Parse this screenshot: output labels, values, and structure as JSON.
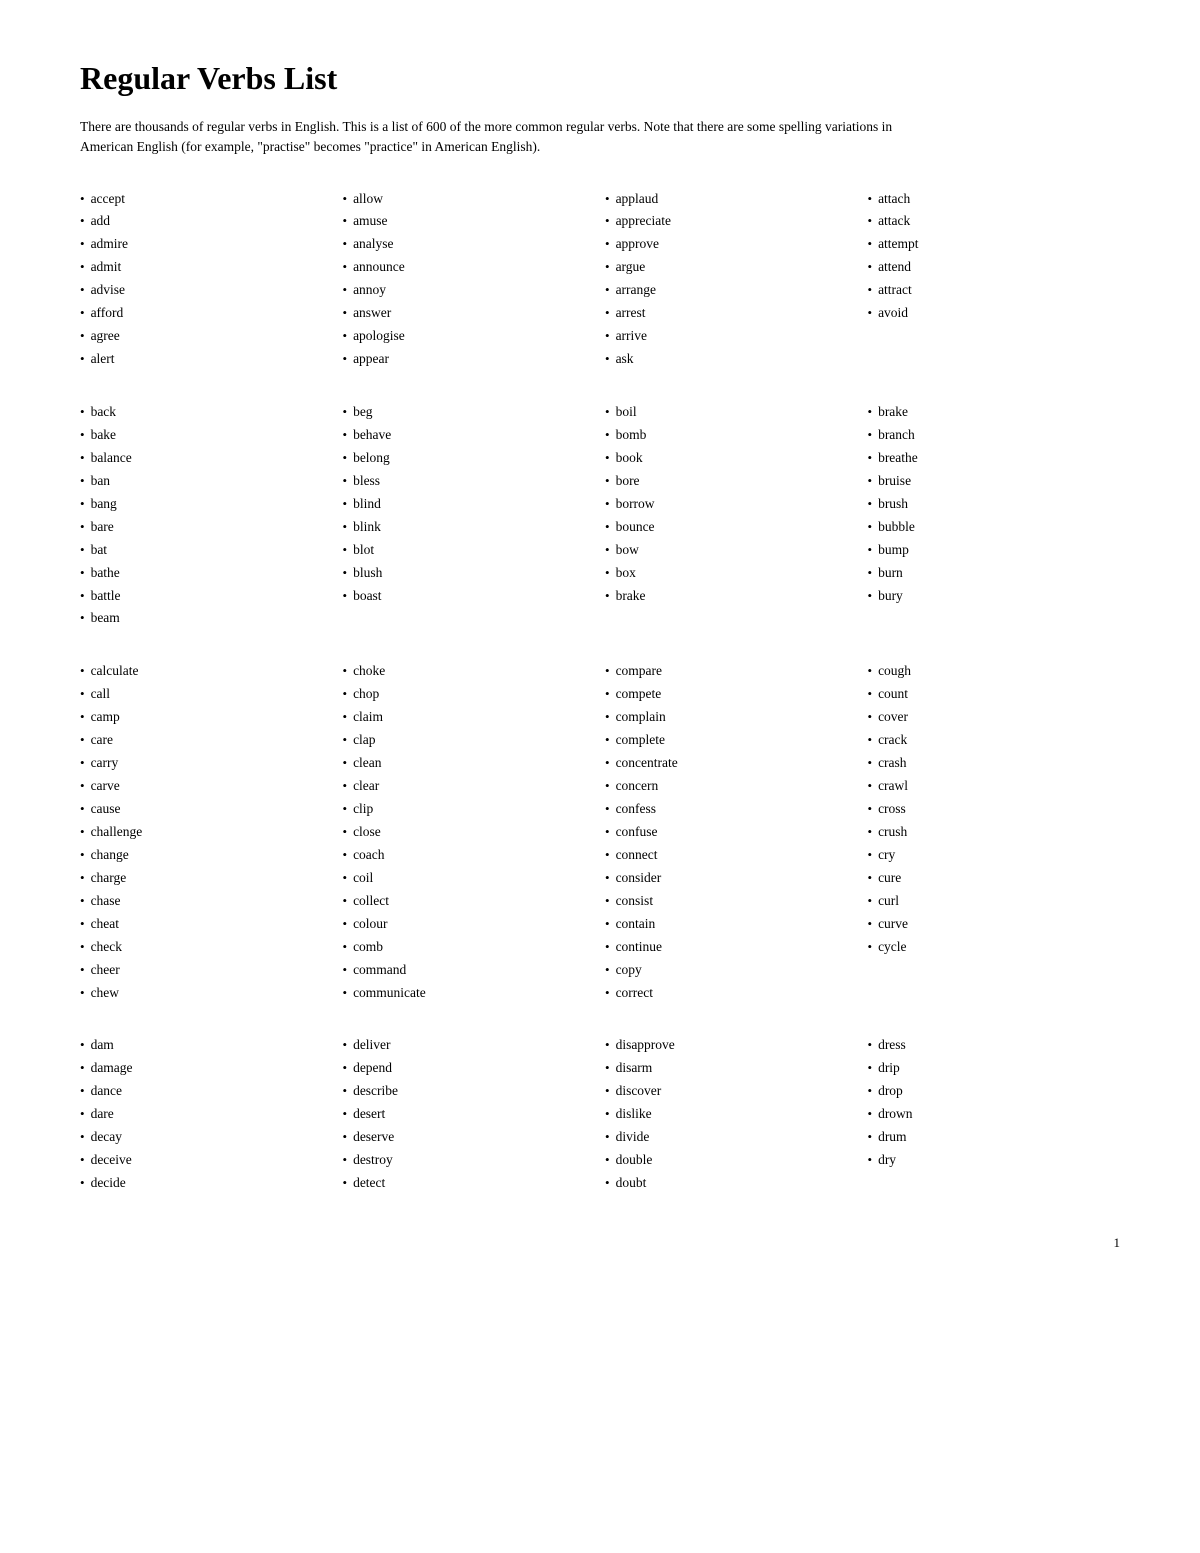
{
  "title": "Regular Verbs List",
  "intro": "There are thousands of regular verbs in English. This is a list of 600 of the more common regular verbs. Note that there are some spelling variations in American English (for example, \"practise\" becomes \"practice\" in American English).",
  "page_number": "1",
  "sections": [
    {
      "id": "a-section",
      "columns": [
        [
          "accept",
          "add",
          "admire",
          "admit",
          "advise",
          "afford",
          "agree",
          "alert"
        ],
        [
          "allow",
          "amuse",
          "analyse",
          "announce",
          "annoy",
          "answer",
          "apologise",
          "appear"
        ],
        [
          "applaud",
          "appreciate",
          "approve",
          "argue",
          "arrange",
          "arrest",
          "arrive",
          "ask"
        ],
        [
          "attach",
          "attack",
          "attempt",
          "attend",
          "attract",
          "avoid"
        ]
      ]
    },
    {
      "id": "b-section",
      "columns": [
        [
          "back",
          "bake",
          "balance",
          "ban",
          "bang",
          "bare",
          "bat",
          "bathe",
          "battle",
          "beam"
        ],
        [
          "beg",
          "behave",
          "belong",
          "bless",
          "blind",
          "blink",
          "blot",
          "blush",
          "boast"
        ],
        [
          "boil",
          "bomb",
          "book",
          "bore",
          "borrow",
          "bounce",
          "bow",
          "box",
          "brake"
        ],
        [
          "brake",
          "branch",
          "breathe",
          "bruise",
          "brush",
          "bubble",
          "bump",
          "burn",
          "bury"
        ]
      ]
    },
    {
      "id": "c-section",
      "columns": [
        [
          "calculate",
          "call",
          "camp",
          "care",
          "carry",
          "carve",
          "cause",
          "challenge",
          "change",
          "charge",
          "chase",
          "cheat",
          "check",
          "cheer",
          "chew"
        ],
        [
          "choke",
          "chop",
          "claim",
          "clap",
          "clean",
          "clear",
          "clip",
          "close",
          "coach",
          "coil",
          "collect",
          "colour",
          "comb",
          "command",
          "communicate"
        ],
        [
          "compare",
          "compete",
          "complain",
          "complete",
          "concentrate",
          "concern",
          "confess",
          "confuse",
          "connect",
          "consider",
          "consist",
          "contain",
          "continue",
          "copy",
          "correct"
        ],
        [
          "cough",
          "count",
          "cover",
          "crack",
          "crash",
          "crawl",
          "cross",
          "crush",
          "cry",
          "cure",
          "curl",
          "curve",
          "cycle"
        ]
      ]
    },
    {
      "id": "d-section",
      "columns": [
        [
          "dam",
          "damage",
          "dance",
          "dare",
          "decay",
          "deceive",
          "decide"
        ],
        [
          "deliver",
          "depend",
          "describe",
          "desert",
          "deserve",
          "destroy",
          "detect"
        ],
        [
          "disapprove",
          "disarm",
          "discover",
          "dislike",
          "divide",
          "double",
          "doubt"
        ],
        [
          "dress",
          "drip",
          "drop",
          "drown",
          "drum",
          "dry"
        ]
      ]
    }
  ]
}
